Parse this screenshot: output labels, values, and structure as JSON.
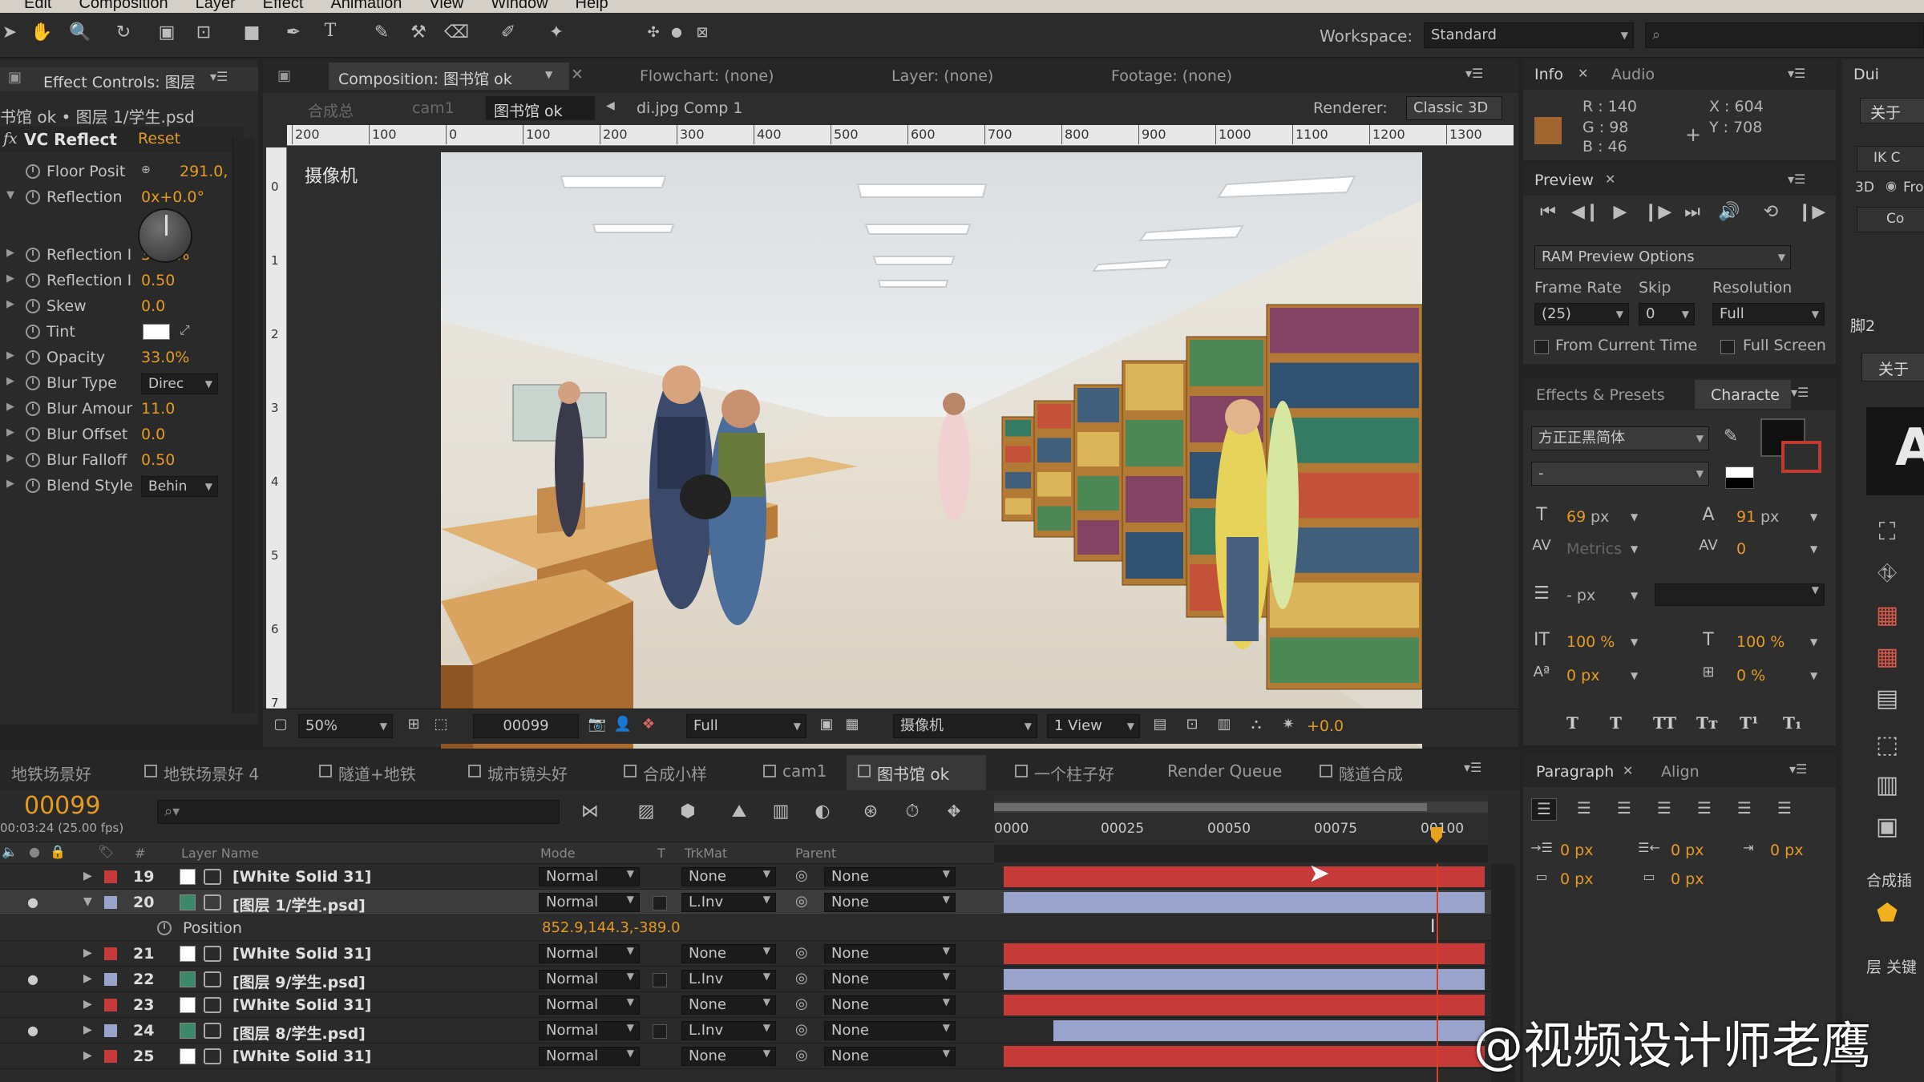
{
  "menu": [
    "Edit",
    "Composition",
    "Layer",
    "Effect",
    "Animation",
    "View",
    "Window",
    "Help"
  ],
  "workspace": {
    "label": "Workspace:",
    "value": "Standard"
  },
  "effect_controls": {
    "tab": "Effect Controls: 图层",
    "breadcrumb": "书馆 ok • 图层 1/学生.psd",
    "effect_name": "VC Reflect",
    "reset": "Reset",
    "params": [
      {
        "name": "Floor Posit",
        "value": "291.0,"
      },
      {
        "name": "Reflection",
        "value": "0x+0.0°"
      },
      {
        "name": "Reflection I",
        "value": "33.0%"
      },
      {
        "name": "Reflection I",
        "value": "0.50"
      },
      {
        "name": "Skew",
        "value": "0.0"
      },
      {
        "name": "Tint",
        "value": ""
      },
      {
        "name": "Opacity",
        "value": "33.0%"
      },
      {
        "name": "Blur Type",
        "value": "Direc"
      },
      {
        "name": "Blur Amour",
        "value": "11.0"
      },
      {
        "name": "Blur Offset",
        "value": "0.0"
      },
      {
        "name": "Blur Falloff",
        "value": "0.50"
      },
      {
        "name": "Blend Style",
        "value": "Behin"
      }
    ]
  },
  "viewer": {
    "tabs": [
      "Composition: 图书馆 ok",
      "Flowchart: (none)",
      "Layer: (none)",
      "Footage: (none)"
    ],
    "comp_nav": [
      "合成总",
      "cam1",
      "图书馆 ok",
      "di.jpg Comp 1"
    ],
    "renderer_label": "Renderer:",
    "renderer_value": "Classic 3D",
    "camera_label": "摄像机",
    "ruler_ticks": [
      "200",
      "100",
      "0",
      "100",
      "200",
      "300",
      "400",
      "500",
      "600",
      "700",
      "800",
      "900",
      "1000",
      "1100",
      "1200",
      "1300"
    ],
    "vruler_ticks": [
      "0",
      "1",
      "2",
      "3",
      "4",
      "5",
      "6",
      "7"
    ],
    "zoom": "50%",
    "frame": "00099",
    "resolution": "Full",
    "camera": "摄像机",
    "view": "1 View",
    "exposure": "+0.0"
  },
  "info": {
    "tabs": [
      "Info",
      "Audio"
    ],
    "r": "R : 140",
    "g": "G : 98",
    "b": "B : 46",
    "x": "X : 604",
    "y": "Y : 708",
    "swatch": "#a0662e"
  },
  "preview": {
    "tab": "Preview",
    "ram_options": "RAM Preview Options",
    "frame_rate_label": "Frame Rate",
    "skip_label": "Skip",
    "resolution_label": "Resolution",
    "frame_rate": "(25)",
    "skip": "0",
    "resolution": "Full",
    "from_current": "From Current Time",
    "full_screen": "Full Screen"
  },
  "character": {
    "tabs": [
      "Effects & Presets",
      "Characte"
    ],
    "font": "方正正黑简体",
    "style": "-",
    "size": "69",
    "leading": "91",
    "px": "px",
    "kerning": "Metrics",
    "tracking": "0",
    "stroke": "- px",
    "vscale": "100 %",
    "hscale": "100 %",
    "baseline": "0 px",
    "tsume": "0 %",
    "styles": [
      "T",
      "T",
      "TT",
      "Tт",
      "T¹",
      "T₁"
    ]
  },
  "paragraph": {
    "tabs": [
      "Paragraph",
      "Align"
    ],
    "values": [
      "0 px",
      "0 px",
      "0 px",
      "0 px",
      "0 px"
    ]
  },
  "far_right": {
    "tab": "Dui",
    "btn1": "关于",
    "btn2": "IK C",
    "label3d": "3D",
    "fro": "Fro",
    "co": "Co",
    "tab2": "脚2",
    "btn3": "关于",
    "lbl1": "合成插",
    "lbl2": "层 关键",
    "big": "A"
  },
  "timeline": {
    "tabs": [
      "地铁场景好",
      "地铁场景好 4",
      "隧道+地铁",
      "城市镜头好",
      "合成小样",
      "cam1",
      "图书馆 ok",
      "一个柱子好",
      "Render Queue",
      "隧道合成"
    ],
    "timecode": "00099",
    "timecode_sub": "00:03:24 (25.00 fps)",
    "search_placeholder": "",
    "columns": {
      "num": "#",
      "name": "Layer Name",
      "mode": "Mode",
      "t": "T",
      "trkmat": "TrkMat",
      "parent": "Parent"
    },
    "ruler": [
      "0000",
      "00025",
      "00050",
      "00075",
      "00100"
    ],
    "layers": [
      {
        "num": "19",
        "name": "[White Solid 31]",
        "mode": "Normal",
        "trkmat": "None",
        "parent": "None",
        "color": "#c63a3a",
        "kind": "solid"
      },
      {
        "num": "20",
        "name": "[图层 1/学生.psd]",
        "mode": "Normal",
        "trkmat": "L.Inv",
        "parent": "None",
        "color": "#9aa3cc",
        "kind": "psd",
        "selected": true
      },
      {
        "num": "21",
        "name": "[White Solid 31]",
        "mode": "Normal",
        "trkmat": "None",
        "parent": "None",
        "color": "#c63a3a",
        "kind": "solid"
      },
      {
        "num": "22",
        "name": "[图层 9/学生.psd]",
        "mode": "Normal",
        "trkmat": "L.Inv",
        "parent": "None",
        "color": "#9aa3cc",
        "kind": "psd"
      },
      {
        "num": "23",
        "name": "[White Solid 31]",
        "mode": "Normal",
        "trkmat": "None",
        "parent": "None",
        "color": "#c63a3a",
        "kind": "solid"
      },
      {
        "num": "24",
        "name": "[图层 8/学生.psd]",
        "mode": "Normal",
        "trkmat": "L.Inv",
        "parent": "None",
        "color": "#9aa3cc",
        "kind": "psd"
      },
      {
        "num": "25",
        "name": "[White Solid 31]",
        "mode": "Normal",
        "trkmat": "None",
        "parent": "None",
        "color": "#c63a3a",
        "kind": "solid"
      }
    ],
    "position_label": "Position",
    "position_value": "852.9,144.3,-389.0"
  },
  "watermark": "@视频设计师老鹰"
}
